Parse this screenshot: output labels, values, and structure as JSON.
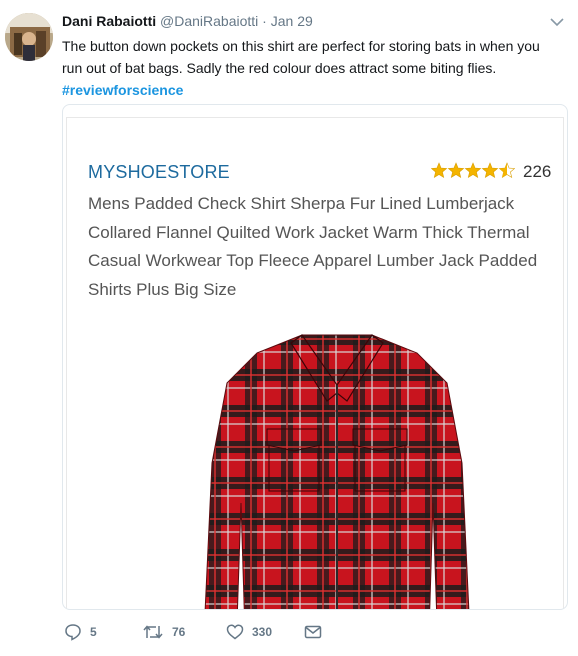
{
  "tweet": {
    "author_name": "Dani Rabaiotti",
    "author_handle": "@DaniRabaiotti",
    "separator": "·",
    "timestamp": "Jan 29",
    "text": "The button down pockets on this shirt are perfect for storing bats in when you run out of bat bags. Sadly the red colour does attract some biting flies.",
    "hashtag": "#reviewforscience"
  },
  "card": {
    "store_name": "MYSHOESTORE",
    "rating": 4.5,
    "rating_max": 5,
    "review_count": "226",
    "product_title": "Mens Padded Check Shirt Sherpa Fur Lined Lumberjack Collared Flannel Quilted Work Jacket Warm Thick Thermal Casual Workwear Top Fleece Apparel Lumber Jack Padded Shirts Plus Big Size",
    "product_image": "red-black-plaid-shirt"
  },
  "actions": {
    "reply_count": "5",
    "retweet_count": "76",
    "like_count": "330"
  },
  "colors": {
    "link_blue": "#1b95e0",
    "store_blue": "#1d6a9e",
    "star_gold": "#f4b400",
    "muted_gray": "#657786",
    "plaid_red": "#c8141e",
    "plaid_black": "#1c1c1c"
  },
  "icons": [
    "chevron-down-icon",
    "reply-icon",
    "retweet-icon",
    "heart-icon",
    "envelope-icon",
    "star-icon"
  ]
}
